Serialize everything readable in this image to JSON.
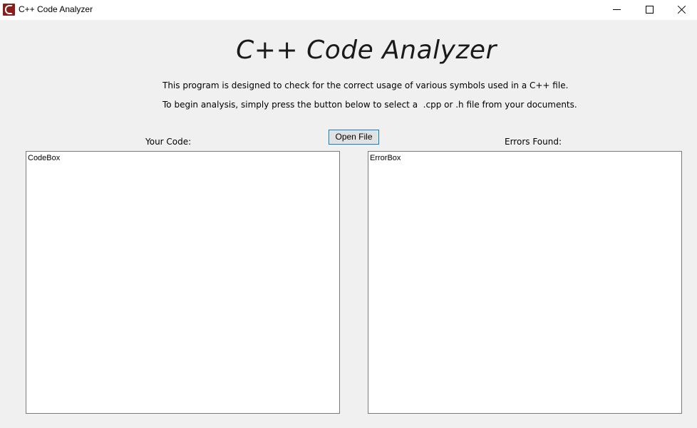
{
  "window": {
    "title": "C++ Code Analyzer",
    "icon": "app-icon"
  },
  "caption_buttons": {
    "minimize": "minimize-icon",
    "maximize": "maximize-icon",
    "close": "close-icon"
  },
  "main": {
    "heading": "C++ Code Analyzer",
    "description_line1": "This program is designed to check for the correct usage of various symbols used in a C++ file.",
    "description_line2": "To begin analysis, simply press the button below to select a  .cpp or .h file from your documents.",
    "open_button_label": "Open File",
    "code_label": "Your Code:",
    "errors_label": "Errors Found:",
    "code_box_text": "CodeBox",
    "error_box_text": "ErrorBox"
  },
  "colors": {
    "background": "#f0f0f0",
    "titlebar": "#ffffff",
    "button_focus_border": "#0078d7",
    "icon_red": "#8b1c1c"
  }
}
